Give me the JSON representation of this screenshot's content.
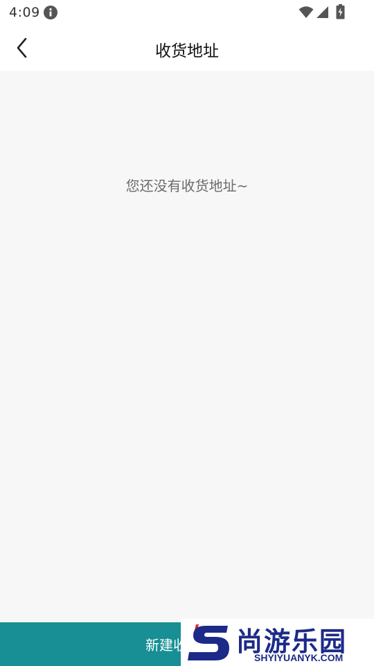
{
  "status_bar": {
    "time": "4:09",
    "icons": [
      "info-icon",
      "wifi-icon",
      "signal-icon",
      "battery-icon"
    ]
  },
  "header": {
    "title": "收货地址",
    "back_icon": "chevron-left-icon"
  },
  "main": {
    "empty_message": "您还没有收货地址~"
  },
  "footer": {
    "new_address_label": "新建收货地址"
  },
  "watermark": {
    "title": "尚游乐园",
    "subtitle": "SHYIYUANYK.COM"
  },
  "colors": {
    "accent": "#178f94",
    "background": "#f7f7f7",
    "watermark_blue": "#1c2a88",
    "watermark_red": "#e0283a"
  }
}
